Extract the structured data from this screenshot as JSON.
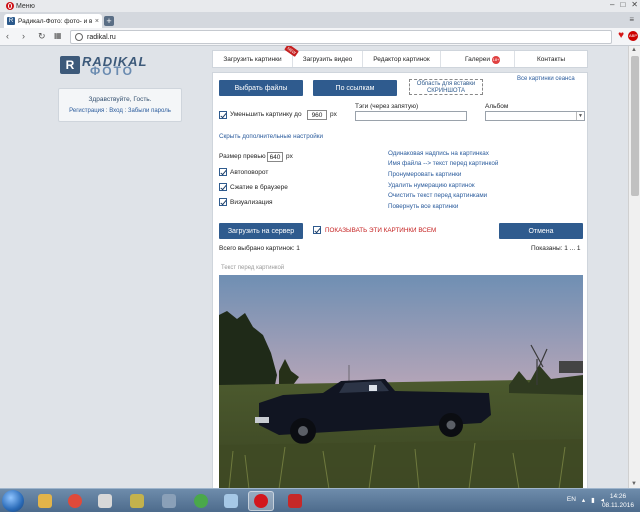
{
  "browser": {
    "menu_label": "Меню",
    "tab_title": "Радикал-Фото: фото- и в",
    "tab_favicon": "R",
    "url": "radikal.ru"
  },
  "site": {
    "logo_word": "RADIKAL",
    "logo_word2": "ФОТО",
    "greeting": "Здравствуйте, Гость.",
    "auth_links": [
      "Регистрация",
      "Вход",
      "Забыли пароль"
    ]
  },
  "nav_tabs": [
    {
      "label": "Загрузить картинки",
      "badge": "NEW"
    },
    {
      "label": "Загрузить видео",
      "badge": ""
    },
    {
      "label": "Редактор картинок",
      "badge": ""
    },
    {
      "label": "Галереи",
      "badge": "18+"
    },
    {
      "label": "Контакты",
      "badge": ""
    }
  ],
  "upload": {
    "choose_files": "Выбрать файлы",
    "by_links": "По ссылкам",
    "paste_area_line1": "Область для вставки",
    "paste_area_line2": "СКРИНШОТА",
    "all_session_pictures": "Все картинки сеанса",
    "reduce_label": "Уменьшить картинку до",
    "reduce_value": "960",
    "px": "px",
    "tags_label": "Тэги (через запятую)",
    "album_label": "Альбом",
    "hide_settings": "Скрыть дополнительные настройки",
    "preview_size_label": "Размер превью",
    "preview_size_value": "640",
    "autorotate": "Автоповорот",
    "browser_compress": "Сжатие в браузере",
    "visualization": "Визуализация",
    "side_links": [
      "Одинаковая надпись на картинках",
      "Имя файла --> текст перед картинкой",
      "Пронумеровать картинки",
      "Удалить нумерацию картинок",
      "Очистить текст перед картинками",
      "Повернуть все картинки"
    ],
    "upload_to_server": "Загрузить на сервер",
    "show_to_all": "ПОКАЗЫВАТЬ ЭТИ КАРТИНКИ ВСЕМ",
    "cancel": "Отмена",
    "total_selected": "Всего выбрано картинок: 1",
    "shown": "Показаны: 1 ... 1",
    "text_before_picture": "Текст перед картинкой"
  },
  "taskbar": {
    "lang": "EN",
    "time": "14:26",
    "date": "08.11.2016"
  },
  "icons": [
    "opera-icon",
    "back-icon",
    "forward-icon",
    "reload-icon",
    "globe-icon",
    "heart-icon",
    "adblock-icon",
    "start-icon"
  ]
}
